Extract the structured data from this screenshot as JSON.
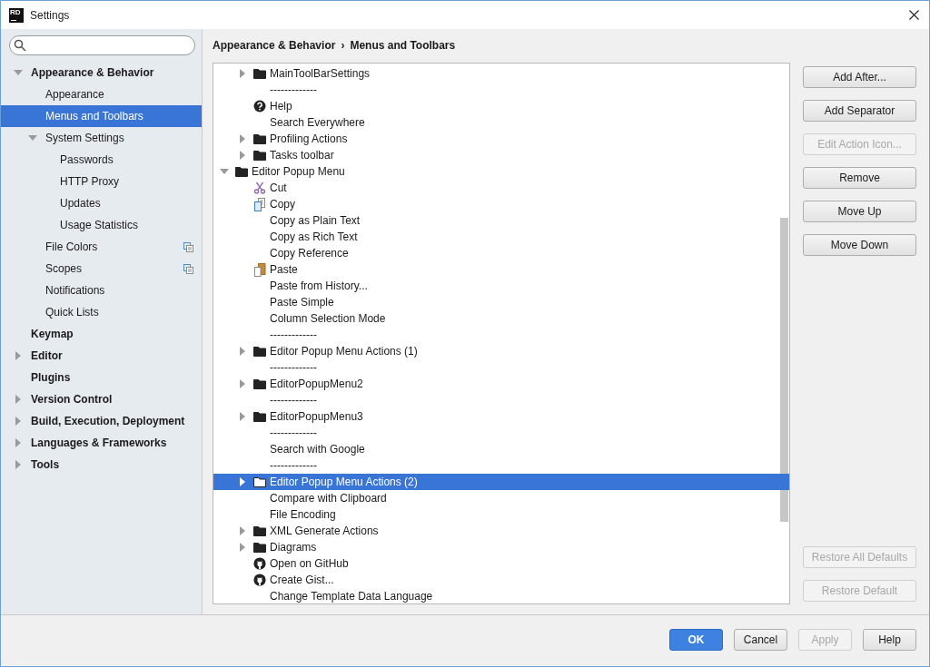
{
  "window": {
    "logo_text": "RD",
    "title": "Settings"
  },
  "sidebar": {
    "items": [
      {
        "label": "Appearance & Behavior",
        "expanded": true,
        "selected": false,
        "children": [
          {
            "label": "Appearance",
            "selected": false,
            "project_scoped": false
          },
          {
            "label": "Menus and Toolbars",
            "selected": true,
            "project_scoped": false
          },
          {
            "label": "System Settings",
            "expanded": true,
            "selected": false,
            "project_scoped": false,
            "children": [
              {
                "label": "Passwords",
                "selected": false
              },
              {
                "label": "HTTP Proxy",
                "selected": false
              },
              {
                "label": "Updates",
                "selected": false
              },
              {
                "label": "Usage Statistics",
                "selected": false
              }
            ]
          },
          {
            "label": "File Colors",
            "selected": false,
            "project_scoped": true
          },
          {
            "label": "Scopes",
            "selected": false,
            "project_scoped": true
          },
          {
            "label": "Notifications",
            "selected": false,
            "project_scoped": false
          },
          {
            "label": "Quick Lists",
            "selected": false,
            "project_scoped": false
          }
        ]
      },
      {
        "label": "Keymap",
        "selected": false
      },
      {
        "label": "Editor",
        "expanded": false,
        "selected": false
      },
      {
        "label": "Plugins",
        "selected": false
      },
      {
        "label": "Version Control",
        "expanded": false,
        "selected": false
      },
      {
        "label": "Build, Execution, Deployment",
        "expanded": false,
        "selected": false
      },
      {
        "label": "Languages & Frameworks",
        "expanded": false,
        "selected": false
      },
      {
        "label": "Tools",
        "expanded": false,
        "selected": false
      }
    ]
  },
  "breadcrumb": {
    "items": [
      "Appearance & Behavior",
      "Menus and Toolbars"
    ],
    "separator": "›"
  },
  "tree": {
    "continued_children": [
      {
        "label": "MainToolBarSettings",
        "kind": "folder",
        "expanded": false,
        "selected": false
      },
      {
        "label": "-------------",
        "kind": "none",
        "selected": false
      },
      {
        "label": "Help",
        "kind": "help",
        "selected": false
      },
      {
        "label": "Search Everywhere",
        "kind": "none",
        "selected": false
      },
      {
        "label": "Profiling Actions",
        "kind": "folder",
        "expanded": false,
        "selected": false
      },
      {
        "label": "Tasks toolbar",
        "kind": "folder",
        "expanded": false,
        "selected": false
      }
    ],
    "nodes": [
      {
        "label": "Editor Popup Menu",
        "kind": "folder",
        "expanded": true,
        "selected": false,
        "children": [
          {
            "label": "Cut",
            "kind": "cut",
            "selected": false
          },
          {
            "label": "Copy",
            "kind": "copy",
            "selected": false
          },
          {
            "label": "Copy as Plain Text",
            "kind": "none",
            "selected": false
          },
          {
            "label": "Copy as Rich Text",
            "kind": "none",
            "selected": false
          },
          {
            "label": "Copy Reference",
            "kind": "none",
            "selected": false
          },
          {
            "label": "Paste",
            "kind": "paste",
            "selected": false
          },
          {
            "label": "Paste from History...",
            "kind": "none",
            "selected": false
          },
          {
            "label": "Paste Simple",
            "kind": "none",
            "selected": false
          },
          {
            "label": "Column Selection Mode",
            "kind": "none",
            "selected": false
          },
          {
            "label": "-------------",
            "kind": "none",
            "selected": false
          },
          {
            "label": "Editor Popup Menu Actions (1)",
            "kind": "folder",
            "expanded": false,
            "selected": false
          },
          {
            "label": "-------------",
            "kind": "none",
            "selected": false
          },
          {
            "label": "EditorPopupMenu2",
            "kind": "folder",
            "expanded": false,
            "selected": false
          },
          {
            "label": "-------------",
            "kind": "none",
            "selected": false
          },
          {
            "label": "EditorPopupMenu3",
            "kind": "folder",
            "expanded": false,
            "selected": false
          },
          {
            "label": "-------------",
            "kind": "none",
            "selected": false
          },
          {
            "label": "Search with Google",
            "kind": "none",
            "selected": false
          },
          {
            "label": "-------------",
            "kind": "none",
            "selected": false
          },
          {
            "label": "Editor Popup Menu Actions (2)",
            "kind": "folder",
            "expanded": false,
            "selected": true
          },
          {
            "label": "Compare with Clipboard",
            "kind": "none",
            "selected": false
          },
          {
            "label": "File Encoding",
            "kind": "none",
            "selected": false
          },
          {
            "label": "XML Generate Actions",
            "kind": "folder",
            "expanded": false,
            "selected": false
          },
          {
            "label": "Diagrams",
            "kind": "folder",
            "expanded": false,
            "selected": false
          },
          {
            "label": "Open on GitHub",
            "kind": "github",
            "selected": false
          },
          {
            "label": "Create Gist...",
            "kind": "github",
            "selected": false
          },
          {
            "label": "Change Template Data Language",
            "kind": "none",
            "selected": false
          }
        ]
      }
    ]
  },
  "side_buttons": [
    {
      "label": "Add After...",
      "disabled": false
    },
    {
      "label": "Add Separator",
      "disabled": false
    },
    {
      "label": "Edit Action Icon...",
      "disabled": true
    },
    {
      "label": "Remove",
      "disabled": false
    },
    {
      "label": "Move Up",
      "disabled": false
    },
    {
      "label": "Move Down",
      "disabled": false
    }
  ],
  "restore_buttons": [
    {
      "label": "Restore All Defaults",
      "disabled": true
    },
    {
      "label": "Restore Default",
      "disabled": true
    }
  ],
  "footer_buttons": [
    {
      "label": "OK",
      "kind": "primary",
      "disabled": false
    },
    {
      "label": "Cancel",
      "kind": "normal",
      "disabled": false
    },
    {
      "label": "Apply",
      "kind": "normal",
      "disabled": true
    },
    {
      "label": "Help",
      "kind": "normal",
      "disabled": false
    }
  ]
}
